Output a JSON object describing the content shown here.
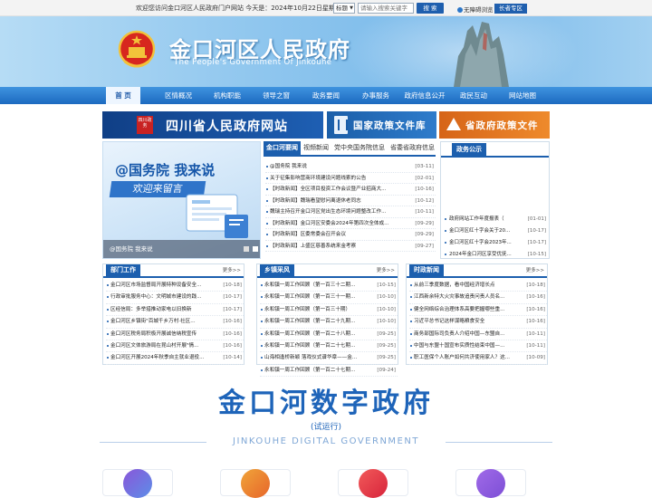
{
  "topbar": {
    "welcome": "欢迎您访问金口河区人民政府门户网站  今天是：2024年10月22日星期二",
    "search_scope": "标题",
    "search_placeholder": "请输入搜索关键字",
    "search_button": "搜  索",
    "access_label": "无障碍浏览",
    "elder_label": "长者专区"
  },
  "banner": {
    "title": "金口河区人民政府",
    "subtitle": "The People's Government Of Jinkouhe"
  },
  "nav": {
    "items": [
      "首  页",
      "区情概况",
      "机构职能",
      "领导之窗",
      "政务要闻",
      "办事服务",
      "政府信息公开",
      "政民互动",
      "网站地图"
    ]
  },
  "strips": {
    "sichuan": "四川省人民政府网站",
    "sichuan_seal": "四川政务",
    "national": "国家政策文件库",
    "provincial": "省政府政策文件"
  },
  "slide": {
    "headline": "@国务院 我来说",
    "ribbon": "欢迎来留言",
    "caption": "@国务院 我来说"
  },
  "news": {
    "tabs": [
      "金口河要闻",
      "视频新闻",
      "党中央国务院信息",
      "省委省政府信息"
    ],
    "items": [
      {
        "title": "@国务院 我来说",
        "date": "[03-11]"
      },
      {
        "title": "关于征集影响营商环境建设问题线索的公告",
        "date": "[02-01]"
      },
      {
        "title": "【时政新闻】全区项目投资工作会议暨产业招商大...",
        "date": "[10-16]"
      },
      {
        "title": "【时政新闻】魏瑞看望慰问离退休老同志",
        "date": "[10-12]"
      },
      {
        "title": "魏瑞主持召开金口河区党出生态环境问题整改工作...",
        "date": "[10-11]"
      },
      {
        "title": "【时政新闻】金口河区安委会2024年第四次全体成...",
        "date": "[09-29]"
      },
      {
        "title": "【时政新闻】区委常委会召开会议",
        "date": "[09-29]"
      },
      {
        "title": "【时政新闻】上盛区慈善系统来金考察",
        "date": "[09-27]"
      }
    ]
  },
  "notice": {
    "title": "政务公示",
    "items": [
      {
        "title": "政府网站工作年度报表（",
        "date": "[01-01]"
      },
      {
        "title": "金口河区红十字会关于20...",
        "date": "[10-17]"
      },
      {
        "title": "金口河区红十字会2023年...",
        "date": "[10-17]"
      },
      {
        "title": "2024年金口河区享受优抚...",
        "date": "[10-15]"
      }
    ]
  },
  "columns": [
    {
      "title": "部门工作",
      "more": "更多>>",
      "items": [
        {
          "title": "金口河区市场监督局开展特种设备安全...",
          "date": "[10-18]"
        },
        {
          "title": "行政审批服务中心：文明城市建设的践...",
          "date": "[10-17]"
        },
        {
          "title": "区经信局：多举措推动家电以旧换新",
          "date": "[10-17]"
        },
        {
          "title": "金口河区乡镇街\"百城千乡万村·社区...",
          "date": "[10-16]"
        },
        {
          "title": "金口河区税务局积极开展诚信纳税宣传",
          "date": "[10-16]"
        },
        {
          "title": "金口河区文体旅游局在昆山村开展\"情...",
          "date": "[10-16]"
        },
        {
          "title": "金口河区开展2024年秋季自主就业退役...",
          "date": "[10-14]"
        }
      ]
    },
    {
      "title": "乡镇采风",
      "more": "更多>>",
      "items": [
        {
          "title": "永和镇一周工作回顾（第一百三十二期...",
          "date": "[10-15]"
        },
        {
          "title": "永和镇一周工作回顾（第一百三十一期...",
          "date": "[10-10]"
        },
        {
          "title": "永和镇一周工作回顾（第一百三十期）",
          "date": "[10-10]"
        },
        {
          "title": "永和镇一周工作回顾（第一百二十九期...",
          "date": "[10-10]"
        },
        {
          "title": "永和镇一周工作回顾（第一百二十八期...",
          "date": "[09-25]"
        },
        {
          "title": "永和镇一周工作回顾（第一百二十七期...",
          "date": "[09-25]"
        },
        {
          "title": "山海相逢桥新颖 落戏仪式谱华章——金...",
          "date": "[09-25]"
        },
        {
          "title": "永和镇一周工作回顾（第一百二十七期...",
          "date": "[09-24]"
        }
      ]
    },
    {
      "title": "时政新闻",
      "more": "更多>>",
      "items": [
        {
          "title": "从前三季度数据，看中国经济增长点",
          "date": "[10-18]"
        },
        {
          "title": "江西新余特大火灾事故追责问责人员名...",
          "date": "[10-16]"
        },
        {
          "title": "健全网络综合治理体系高要把握哪些重...",
          "date": "[10-16]"
        },
        {
          "title": "习近平总书记这样谋略粮食安全",
          "date": "[10-16]"
        },
        {
          "title": "商务部国际司负责人介绍中国—东盟自...",
          "date": "[10-11]"
        },
        {
          "title": "中国与东盟十国宣布实质性结束中国—...",
          "date": "[10-11]"
        },
        {
          "title": "职工医保个人账户如何共济使用家人？这...",
          "date": "[10-09]"
        }
      ]
    }
  ],
  "digital": {
    "title": "金口河数字政府",
    "subtitle": "(试运行)",
    "english": "JINKOUHE DIGITAL GOVERNMENT"
  },
  "colors": {
    "nav_blue": "#1c6ac0",
    "accent_blue": "#1c5fae",
    "orange": "#e07a25"
  }
}
